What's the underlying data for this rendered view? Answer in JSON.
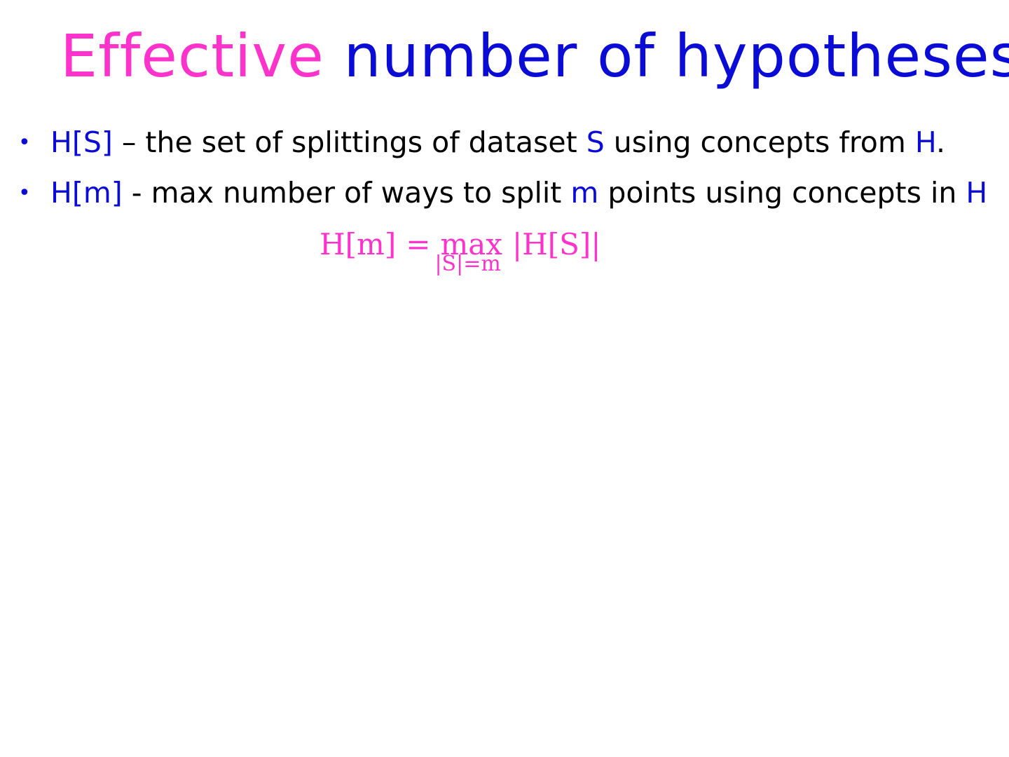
{
  "title": {
    "part1": "Effective",
    "part2": "number of hypotheses"
  },
  "bullets": [
    {
      "term": "H[S]",
      "text1": " – the set of splittings of dataset ",
      "var1": "S",
      "text2": " using concepts from ",
      "var2": "H",
      "text3": "."
    },
    {
      "term": "H[m]",
      "text1": " - max number of ways to split ",
      "var1": "m",
      "text2": " points using concepts in ",
      "var2": "H"
    }
  ],
  "formula": {
    "lhs": "H[m]",
    "equals": "=",
    "operator": "max",
    "subscript": "|S|=m",
    "rhs": "|H[S]|"
  },
  "colors": {
    "title_pink": "#ff33cc",
    "accent_blue": "#0b0bd6",
    "text": "#000000"
  }
}
